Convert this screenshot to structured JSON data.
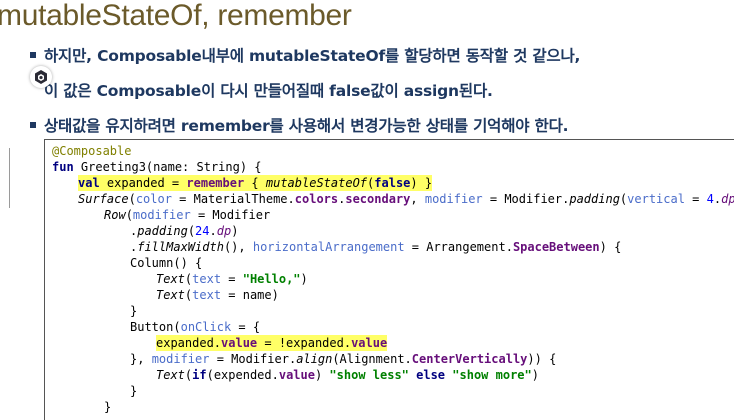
{
  "title": "mutableStateOf, remember",
  "bullets": [
    "하지만, Composable내부에 mutableStateOf를 할당하면 동작할 것 같으나,",
    "이 값은 Composable이 다시 만들어질때 false값이 assign된다.",
    "상태값을 유지하려면 remember를 사용해서 변경가능한 상태를 기억해야 한다."
  ],
  "code": {
    "l1": {
      "a": "@Composable"
    },
    "l2": {
      "kw": "fun",
      "rest": " Greeting3(name: String) {"
    },
    "l3": {
      "kw": "val",
      "a": " expanded = ",
      "b": "remember",
      "c": " { ",
      "d": "mutableStateOf",
      "e": "(",
      "f": "false",
      "g": ") }"
    },
    "l4": {
      "a": "Surface",
      "b": "(",
      "c": "color",
      "d": " = MaterialTheme.",
      "e": "colors",
      "f": ".",
      "g": "secondary",
      "h": ", ",
      "i": "modifier",
      "j": " = Modifier.",
      "k": "padding",
      "l": "(",
      "m": "vertical",
      "n": " = ",
      "o": "4",
      "p": ".",
      "q": "dp",
      "r": ")) {"
    },
    "l5": {
      "a": "Row",
      "b": "(",
      "c": "modifier",
      "d": " = Modifier"
    },
    "l6": {
      "a": ".",
      "b": "padding",
      "c": "(",
      "d": "24",
      "e": ".",
      "f": "dp",
      "g": ")"
    },
    "l7": {
      "a": ".",
      "b": "fillMaxWidth",
      "c": "(), ",
      "d": "horizontalArrangement",
      "e": " = Arrangement.",
      "f": "SpaceBetween",
      "g": ") {"
    },
    "l8": {
      "a": "Column",
      "b": "() {"
    },
    "l9": {
      "a": "Text",
      "b": "(",
      "c": "text",
      "d": " = ",
      "e": "\"Hello,\"",
      "f": ")"
    },
    "l10": {
      "a": "Text",
      "b": "(",
      "c": "text",
      "d": " = name)"
    },
    "l11": {
      "a": "}"
    },
    "l12": {
      "a": "Button",
      "b": "(",
      "c": "onClick",
      "d": " = {"
    },
    "l13": {
      "a": "expanded.",
      "b": "value",
      "c": " = !expanded.",
      "d": "value"
    },
    "l14": {
      "a": "}, ",
      "b": "modifier",
      "c": " = Modifier.",
      "d": "align",
      "e": "(Alignment.",
      "f": "CenterVertically",
      "g": ")) {"
    },
    "l15": {
      "a": "Text",
      "b": "(",
      "kw1": "if",
      "c": "(expended.",
      "d": "value",
      "e": ") ",
      "f": "\"show less\"",
      "kw2": " else ",
      "g": "\"show more\"",
      "h": ")"
    },
    "l16": {
      "a": "}"
    },
    "l17": {
      "a": "}"
    }
  },
  "colors": {
    "title": "#6b5a2a",
    "bullet_text": "#1e3860",
    "highlight": "#ffff66",
    "keyword": "#000080",
    "string": "#008000",
    "number": "#0000ff",
    "annotation": "#808000",
    "field": "#660e7a",
    "param": "#4a6cc9"
  },
  "icons": {
    "badge": "hexagon-icon"
  }
}
